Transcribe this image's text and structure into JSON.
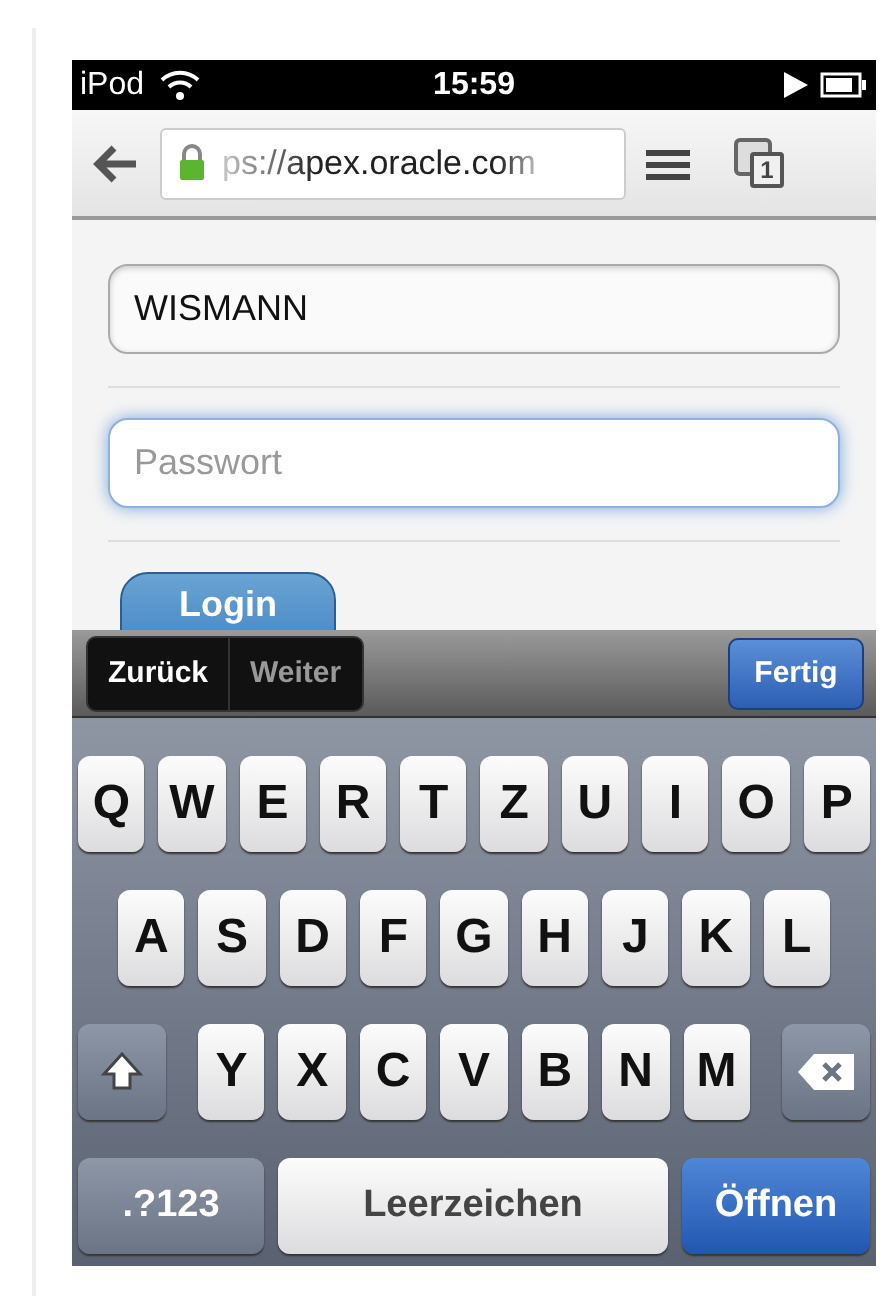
{
  "status_bar": {
    "carrier": "iPod",
    "time": "15:59"
  },
  "browser_toolbar": {
    "url": "ps://apex.oracle.com",
    "secure": true,
    "tab_count": "1"
  },
  "form": {
    "fields": [
      {
        "kind": "text",
        "value": "WISMANN",
        "focused": false
      },
      {
        "kind": "password",
        "placeholder": "Passwort",
        "focused": true
      }
    ],
    "login_button": "Login"
  },
  "accessory_bar": {
    "nav": [
      {
        "label": "Zurück",
        "disabled": false
      },
      {
        "label": "Weiter",
        "disabled": true
      }
    ],
    "done": "Fertig"
  },
  "keyboard": {
    "rows": [
      {
        "keys": [
          {
            "kind": "letter",
            "label": "Q"
          },
          {
            "kind": "letter",
            "label": "W"
          },
          {
            "kind": "letter",
            "label": "E"
          },
          {
            "kind": "letter",
            "label": "R"
          },
          {
            "kind": "letter",
            "label": "T"
          },
          {
            "kind": "letter",
            "label": "Z"
          },
          {
            "kind": "letter",
            "label": "U"
          },
          {
            "kind": "letter",
            "label": "I"
          },
          {
            "kind": "letter",
            "label": "O"
          },
          {
            "kind": "letter",
            "label": "P"
          }
        ]
      },
      {
        "keys": [
          {
            "kind": "letter",
            "label": "A"
          },
          {
            "kind": "letter",
            "label": "S"
          },
          {
            "kind": "letter",
            "label": "D"
          },
          {
            "kind": "letter",
            "label": "F"
          },
          {
            "kind": "letter",
            "label": "G"
          },
          {
            "kind": "letter",
            "label": "H"
          },
          {
            "kind": "letter",
            "label": "J"
          },
          {
            "kind": "letter",
            "label": "K"
          },
          {
            "kind": "letter",
            "label": "L"
          }
        ]
      },
      {
        "keys": [
          {
            "kind": "shift"
          },
          {
            "kind": "letter",
            "label": "Y"
          },
          {
            "kind": "letter",
            "label": "X"
          },
          {
            "kind": "letter",
            "label": "C"
          },
          {
            "kind": "letter",
            "label": "V"
          },
          {
            "kind": "letter",
            "label": "B"
          },
          {
            "kind": "letter",
            "label": "N"
          },
          {
            "kind": "letter",
            "label": "M"
          },
          {
            "kind": "backspace"
          }
        ]
      },
      {
        "keys": [
          {
            "kind": "mode",
            "label": ".?123"
          },
          {
            "kind": "space",
            "label": "Leerzeichen"
          },
          {
            "kind": "return",
            "label": "Öffnen"
          }
        ]
      }
    ]
  }
}
